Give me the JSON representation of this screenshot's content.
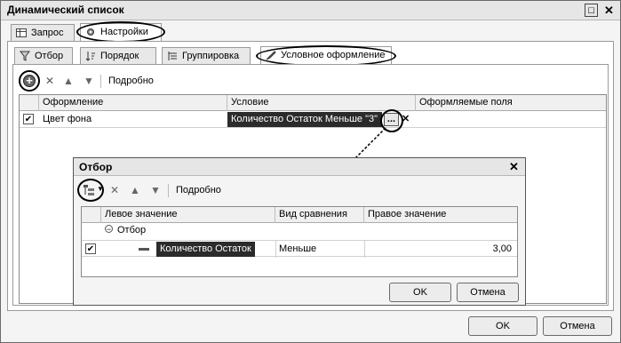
{
  "window": {
    "title": "Динамический список"
  },
  "outer_tabs": [
    {
      "label": "Запрос"
    },
    {
      "label": "Настройки"
    }
  ],
  "inner_tabs": [
    {
      "label": "Отбор"
    },
    {
      "label": "Порядок"
    },
    {
      "label": "Группировка"
    },
    {
      "label": "Условное оформление"
    }
  ],
  "toolbar": {
    "details_label": "Подробно"
  },
  "cond_grid": {
    "columns": [
      "Оформление",
      "Условие",
      "Оформляемые поля"
    ],
    "row": {
      "checked": true,
      "appearance": "Цвет фона",
      "condition": "Количество Остаток Меньше \"3\"",
      "ellipsis": "...",
      "clear": "✕"
    }
  },
  "filter_dialog": {
    "title": "Отбор",
    "toolbar_details": "Подробно",
    "columns": [
      "Левое значение",
      "Вид сравнения",
      "Правое значение"
    ],
    "group_row": {
      "label": "Отбор"
    },
    "item_row": {
      "checked": true,
      "left": "Количество Остаток",
      "comparison": "Меньше",
      "right": "3,00"
    },
    "ok_label": "OK",
    "cancel_label": "Отмена"
  },
  "footer": {
    "ok_label": "OK",
    "cancel_label": "Отмена"
  },
  "colors": {
    "titlebar": "#e6e6e6",
    "selection": "#2b2b2b",
    "panel": "#ffffff"
  }
}
